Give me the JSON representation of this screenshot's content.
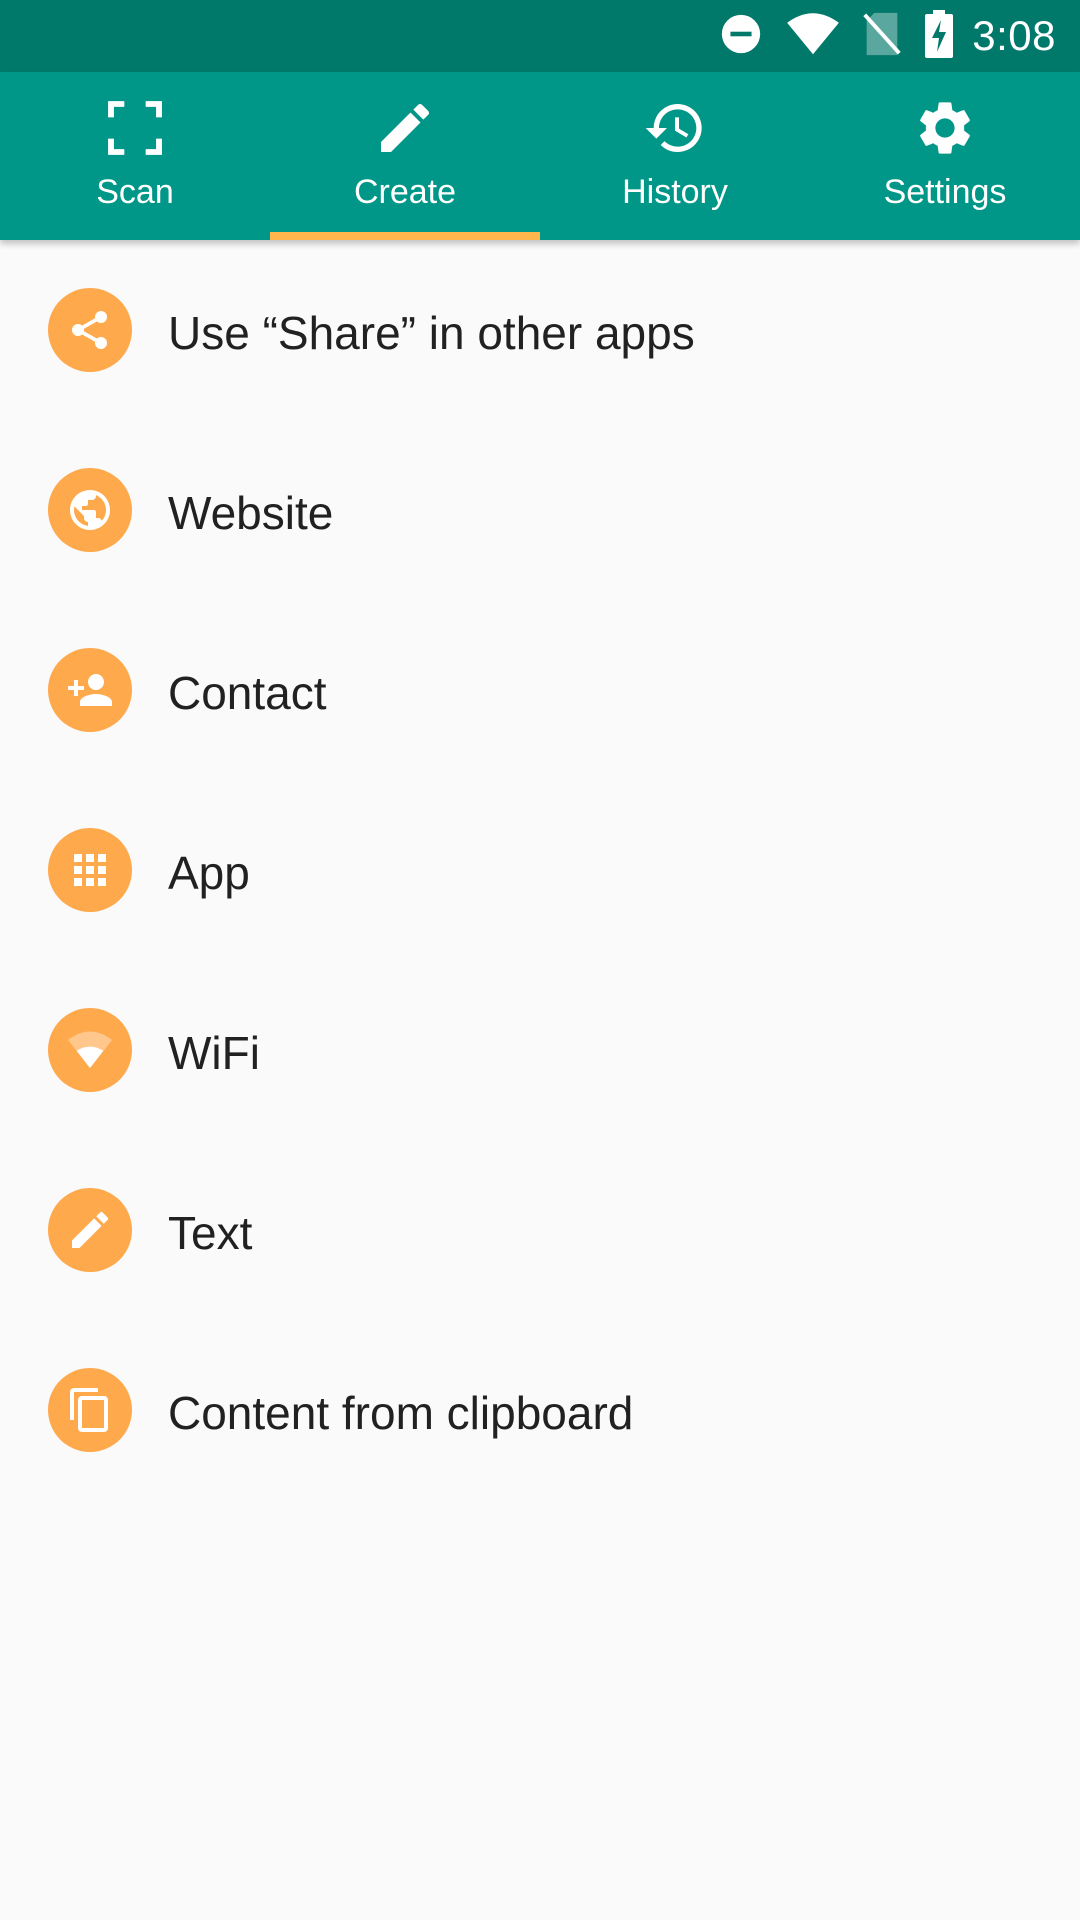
{
  "status_bar": {
    "time": "3:08",
    "icons": [
      "do-not-disturb-icon",
      "wifi-icon",
      "no-sim-icon",
      "battery-charging-icon"
    ]
  },
  "tabs": [
    {
      "label": "Scan",
      "icon": "scan-icon",
      "selected": false
    },
    {
      "label": "Create",
      "icon": "pencil-icon",
      "selected": true
    },
    {
      "label": "History",
      "icon": "history-icon",
      "selected": false
    },
    {
      "label": "Settings",
      "icon": "gear-icon",
      "selected": false
    }
  ],
  "create_options": [
    {
      "label": "Use “Share” in other apps",
      "icon": "share-icon"
    },
    {
      "label": "Website",
      "icon": "globe-icon"
    },
    {
      "label": "Contact",
      "icon": "add-contact-icon"
    },
    {
      "label": "App",
      "icon": "apps-grid-icon"
    },
    {
      "label": "WiFi",
      "icon": "wifi-icon"
    },
    {
      "label": "Text",
      "icon": "pencil-icon"
    },
    {
      "label": "Content from clipboard",
      "icon": "clipboard-copy-icon"
    }
  ],
  "colors": {
    "status_bar": "#00796b",
    "tab_bar": "#009688",
    "tab_indicator": "#ffb74d",
    "item_icon_background": "#ffa94d",
    "background": "#fafafa",
    "text": "#212121"
  }
}
